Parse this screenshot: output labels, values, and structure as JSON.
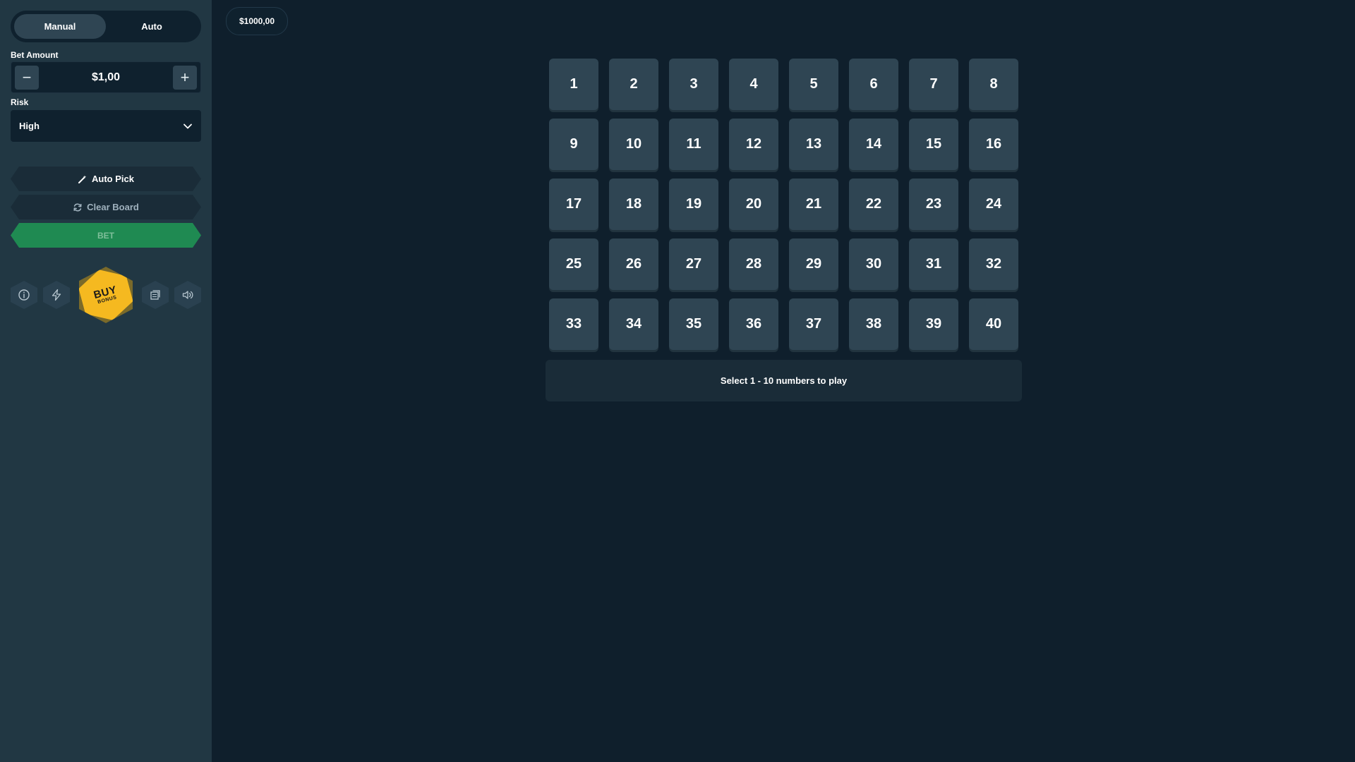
{
  "balance": "$1000,00",
  "mode_toggle": {
    "manual_label": "Manual",
    "auto_label": "Auto",
    "active": "Manual"
  },
  "bet_amount": {
    "label": "Bet Amount",
    "value": "$1,00",
    "decrease_symbol": "−",
    "increase_symbol": "+"
  },
  "risk": {
    "label": "Risk",
    "selected": "High"
  },
  "buttons": {
    "auto_pick": "Auto Pick",
    "clear_board": "Clear Board",
    "bet": "BET"
  },
  "buy_bonus": {
    "line1": "BUY",
    "line2": "BONUS"
  },
  "icons": [
    "info-icon",
    "lightning-icon",
    "buy-bonus-icon",
    "stack-icon",
    "sound-icon"
  ],
  "board": {
    "numbers": [
      "1",
      "2",
      "3",
      "4",
      "5",
      "6",
      "7",
      "8",
      "9",
      "10",
      "11",
      "12",
      "13",
      "14",
      "15",
      "16",
      "17",
      "18",
      "19",
      "20",
      "21",
      "22",
      "23",
      "24",
      "25",
      "26",
      "27",
      "28",
      "29",
      "30",
      "31",
      "32",
      "33",
      "34",
      "35",
      "36",
      "37",
      "38",
      "39",
      "40"
    ],
    "message": "Select 1 - 10 numbers to play"
  },
  "colors": {
    "background": "#0f1f2c",
    "sidebar": "#213743",
    "tile": "#2f4553",
    "bet_button": "#1f8a52",
    "buy_bonus": "#f5b920"
  }
}
